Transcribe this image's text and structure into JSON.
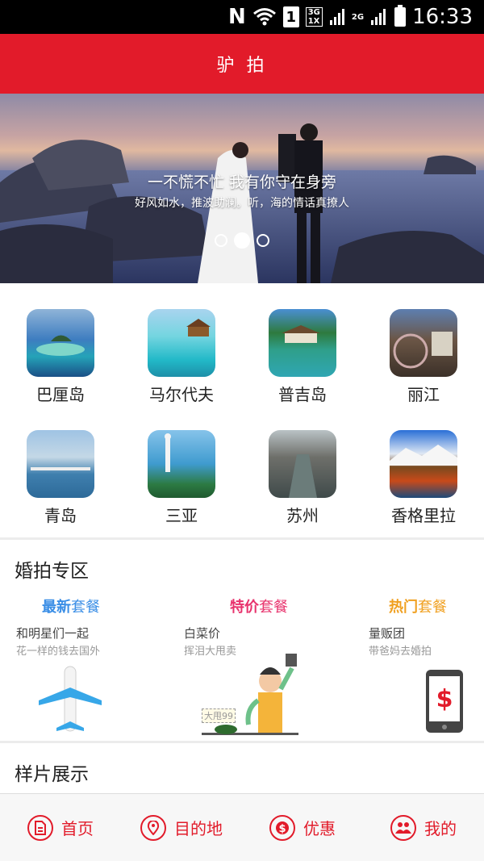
{
  "status_bar": {
    "network_letter": "N",
    "sim": "1",
    "net1_top": "3G",
    "net1_bottom": "1X",
    "net2": "2G",
    "time": "16:33"
  },
  "header": {
    "title": "驴 拍"
  },
  "banner": {
    "line1": "一不慌不忙 我有你守在身旁",
    "line2": "好风如水，推波助澜。听，海的情话真撩人"
  },
  "destinations": [
    {
      "label": "巴厘岛"
    },
    {
      "label": "马尔代夫"
    },
    {
      "label": "普吉岛"
    },
    {
      "label": "丽江"
    },
    {
      "label": "青岛"
    },
    {
      "label": "三亚"
    },
    {
      "label": "苏州"
    },
    {
      "label": "香格里拉"
    }
  ],
  "wedding": {
    "title": "婚拍专区",
    "promos": [
      {
        "title_a": "最新",
        "title_b": "套餐",
        "sub": "和明星们一起",
        "desc": "花一样的钱去国外",
        "color": "#3a8ee6"
      },
      {
        "title_a": "特价",
        "title_b": "套餐",
        "sub": "白菜价",
        "desc": "挥泪大甩卖",
        "color": "#e8336d"
      },
      {
        "title_a": "热门",
        "title_b": "套餐",
        "sub": "量贩团",
        "desc": "带爸妈去婚拍",
        "color": "#f0a020"
      }
    ],
    "sign_text": "大甩99"
  },
  "samples": {
    "title": "样片展示"
  },
  "bottom_nav": [
    {
      "label": "首页",
      "icon": "document-icon"
    },
    {
      "label": "目的地",
      "icon": "location-pin-icon"
    },
    {
      "label": "优惠",
      "icon": "dollar-coin-icon"
    },
    {
      "label": "我的",
      "icon": "people-icon"
    }
  ],
  "colors": {
    "brand_red": "#e21b2a"
  }
}
